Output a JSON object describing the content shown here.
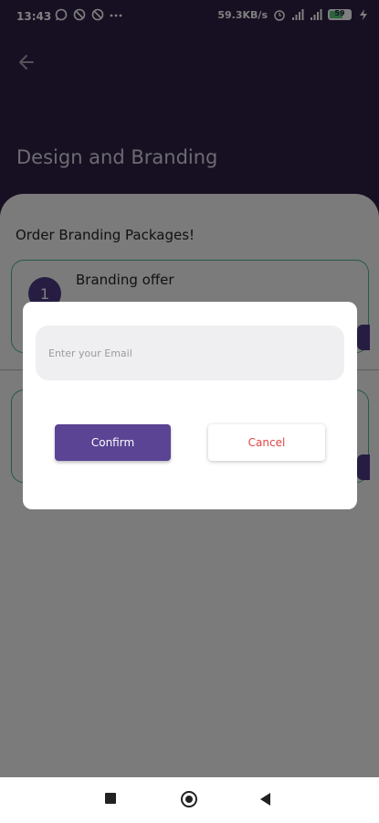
{
  "status_bar": {
    "time": "13:43",
    "network_speed": "59.3KB/s",
    "battery_level": "59",
    "icons": [
      "whatsapp-icon",
      "mute-icon",
      "mute-icon",
      "more-icon",
      "alarm-icon",
      "signal-icon",
      "signal-icon",
      "battery-icon",
      "charging-icon"
    ]
  },
  "header": {
    "title": "Design and Branding",
    "background_color": "#2f2046"
  },
  "main": {
    "section_title": "Order Branding Packages!",
    "cards": [
      {
        "number": "1",
        "title": "Branding offer"
      },
      {
        "number": "",
        "title": ""
      }
    ],
    "card_border_color": "#49b486"
  },
  "dialog": {
    "email_placeholder": "Enter your Email",
    "confirm_label": "Confirm",
    "cancel_label": "Cancel",
    "confirm_color": "#5a4493",
    "cancel_text_color": "#e04545"
  },
  "nav_bar": {
    "icons": [
      "recent-apps-icon",
      "home-icon",
      "back-icon"
    ]
  }
}
